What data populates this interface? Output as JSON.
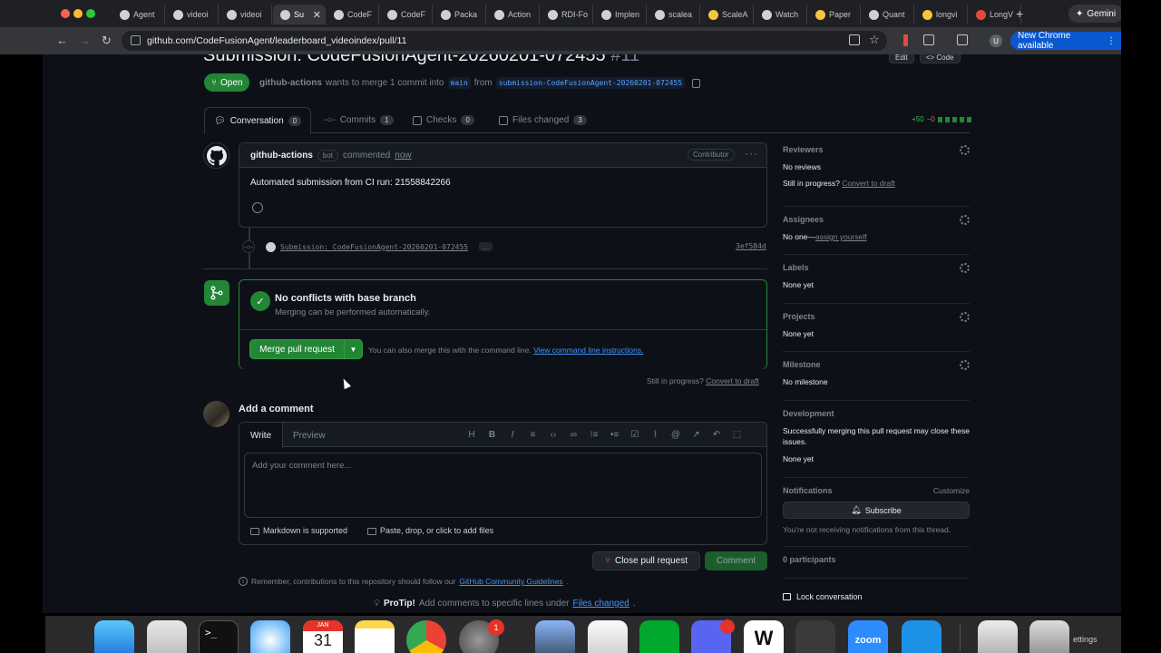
{
  "browser": {
    "tabs": [
      {
        "label": "Agent",
        "icon": "generic"
      },
      {
        "label": "videoi",
        "icon": "generic"
      },
      {
        "label": "videoi",
        "icon": "generic"
      },
      {
        "label": "Su",
        "icon": "github",
        "active": true,
        "close": "✕"
      },
      {
        "label": "CodeF",
        "icon": "github"
      },
      {
        "label": "CodeF",
        "icon": "github"
      },
      {
        "label": "Packa",
        "icon": "github"
      },
      {
        "label": "Action",
        "icon": "github"
      },
      {
        "label": "RDI-Fo",
        "icon": "github"
      },
      {
        "label": "Implen",
        "icon": "github"
      },
      {
        "label": "scalea",
        "icon": "github"
      },
      {
        "label": "ScaleA",
        "icon": "emoji"
      },
      {
        "label": "Watch",
        "icon": "generic"
      },
      {
        "label": "Paper",
        "icon": "emoji"
      },
      {
        "label": "Quant",
        "icon": "github"
      },
      {
        "label": "longvi",
        "icon": "emoji"
      },
      {
        "label": "LongV",
        "icon": "red"
      }
    ],
    "new_tab": "+",
    "gemini_label": "Gemini",
    "url": "github.com/CodeFusionAgent/leaderboard_videoindex/pull/11",
    "new_chrome_label": "New Chrome available",
    "user_initial": "U"
  },
  "pr": {
    "title": "Submission: CodeFusionAgent-20260201-072455",
    "number": "#11",
    "edit_label": "Edit",
    "code_label": "<> Code",
    "state": "Open",
    "author": "github-actions",
    "merge_text": "wants to merge 1 commit into",
    "base_branch": "main",
    "from_text": "from",
    "head_branch": "submission-CodeFusionAgent-20260201-072455",
    "tabs": [
      {
        "label": "Conversation",
        "count": "0"
      },
      {
        "label": "Commits",
        "count": "1"
      },
      {
        "label": "Checks",
        "count": "0"
      },
      {
        "label": "Files changed",
        "count": "3"
      }
    ],
    "additions": "+50",
    "deletions": "−0"
  },
  "comment": {
    "author": "github-actions",
    "bot_label": "bot",
    "action": "commented",
    "time": "now",
    "role": "Contributor",
    "body": "Automated submission from CI run: 21558842266"
  },
  "commit": {
    "message": "Submission: CodeFusionAgent-20260201-072455",
    "ellipsis": "…",
    "sha": "3ef584d"
  },
  "merge": {
    "title": "No conflicts with base branch",
    "subtitle": "Merging can be performed automatically.",
    "button": "Merge pull request",
    "hint": "You can also merge this with the command line.",
    "hint_link": "View command line instructions.",
    "still_label": "Still in progress?",
    "draft_link": "Convert to draft"
  },
  "add_comment": {
    "heading": "Add a comment",
    "write_tab": "Write",
    "preview_tab": "Preview",
    "placeholder": "Add your comment here...",
    "markdown_label": "Markdown is supported",
    "files_label": "Paste, drop, or click to add files",
    "close_button": "Close pull request",
    "comment_button": "Comment",
    "remember_text": "Remember, contributions to this repository should follow our",
    "guidelines_link": "GitHub Community Guidelines",
    "protip_label": "ProTip!",
    "protip_text": "Add comments to specific lines under",
    "protip_link": "Files changed"
  },
  "sidebar": {
    "reviewers": {
      "title": "Reviewers",
      "value": "No reviews",
      "extra": "Still in progress?",
      "extra_link": "Convert to draft"
    },
    "assignees": {
      "title": "Assignees",
      "value": "No one—",
      "link": "assign yourself"
    },
    "labels": {
      "title": "Labels",
      "value": "None yet"
    },
    "projects": {
      "title": "Projects",
      "value": "None yet"
    },
    "milestone": {
      "title": "Milestone",
      "value": "No milestone"
    },
    "development": {
      "title": "Development",
      "text": "Successfully merging this pull request may close these issues.",
      "value": "None yet"
    },
    "notifications": {
      "title": "Notifications",
      "customize": "Customize",
      "button": "Subscribe",
      "text": "You're not receiving notifications from this thread."
    },
    "participants": "0 participants",
    "lock": "Lock conversation"
  },
  "dock": {
    "calendar_month": "JAN",
    "calendar_day": "31",
    "settings_badge": "1",
    "zoom_label": "zoom",
    "settings_text": "ettings"
  }
}
